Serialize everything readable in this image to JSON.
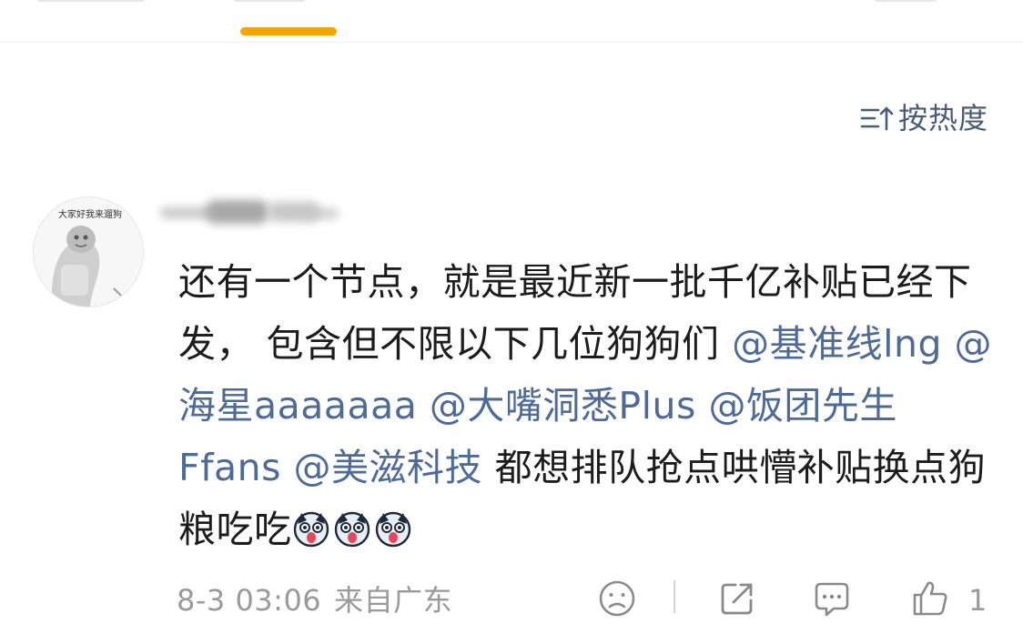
{
  "header": {
    "active_tab_indicator_color": "#f7a400"
  },
  "sort": {
    "icon": "sort-icon",
    "label": "按热度"
  },
  "comment": {
    "avatar": {
      "icon": "avatar-image",
      "caption": "大家好我来遛狗"
    },
    "username_obscured": true,
    "text_parts": [
      {
        "type": "text",
        "value": "还有一个节点，就是最近新一批千亿补贴已经下发， 包含但不限以下几位狗狗们 "
      },
      {
        "type": "mention",
        "value": "@基准线lng"
      },
      {
        "type": "text",
        "value": " "
      },
      {
        "type": "mention",
        "value": "@海星aaaaaaa"
      },
      {
        "type": "text",
        "value": " "
      },
      {
        "type": "mention",
        "value": "@大嘴洞悉Plus"
      },
      {
        "type": "text",
        "value": " "
      },
      {
        "type": "mention",
        "value": "@饭团先生Ffans"
      },
      {
        "type": "text",
        "value": "  "
      },
      {
        "type": "mention",
        "value": "@美滋科技"
      },
      {
        "type": "text",
        "value": " 都想排队抢点哄懵补贴换点狗粮吃吃"
      }
    ],
    "emojis": [
      "dog-emoji",
      "dog-emoji",
      "dog-emoji"
    ],
    "time": "8-3 03:06",
    "location": "来自广东",
    "actions": {
      "dislike_icon": "frown-face-icon",
      "share_icon": "share-icon",
      "reply_icon": "comment-icon",
      "like_icon": "thumbs-up-icon",
      "like_count": "1"
    },
    "colors": {
      "mention": "#4e6a96",
      "text": "#1c1c1c",
      "meta": "#9a9a9a"
    }
  }
}
